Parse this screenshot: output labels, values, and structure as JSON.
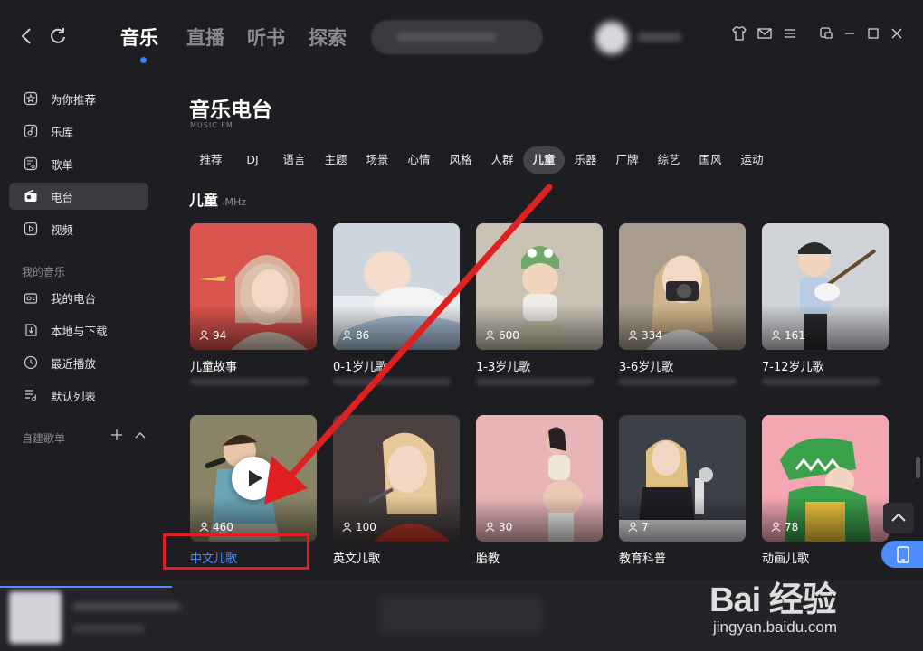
{
  "topbar": {
    "tabs": [
      "音乐",
      "直播",
      "听书",
      "探索"
    ],
    "active_tab": "音乐"
  },
  "sidebar": {
    "items": [
      {
        "label": "为你推荐",
        "icon": "star-icon"
      },
      {
        "label": "乐库",
        "icon": "music-library-icon"
      },
      {
        "label": "歌单",
        "icon": "playlist-icon"
      },
      {
        "label": "电台",
        "icon": "radio-icon",
        "active": true
      },
      {
        "label": "视频",
        "icon": "video-icon"
      }
    ],
    "my_music_title": "我的音乐",
    "my_items": [
      {
        "label": "我的电台",
        "icon": "my-radio-icon"
      },
      {
        "label": "本地与下载",
        "icon": "download-icon"
      },
      {
        "label": "最近播放",
        "icon": "clock-icon"
      },
      {
        "label": "默认列表",
        "icon": "list-icon"
      }
    ],
    "custom_title": "自建歌单"
  },
  "content": {
    "title": "音乐电台",
    "subtitle": "MUSIC FM",
    "categories": [
      "推荐",
      "DJ",
      "语言",
      "主题",
      "场景",
      "心情",
      "风格",
      "人群",
      "儿童",
      "乐器",
      "厂牌",
      "综艺",
      "国风",
      "运动"
    ],
    "active_category": "儿童",
    "section_title": "儿童",
    "section_unit": ".MHz",
    "cards": [
      {
        "name": "儿童故事",
        "count": "94",
        "color": "#d9534f"
      },
      {
        "name": "0-1岁儿歌",
        "count": "86",
        "color": "#cdd6de"
      },
      {
        "name": "1-3岁儿歌",
        "count": "600",
        "color": "#c9c2b4"
      },
      {
        "name": "3-6岁儿歌",
        "count": "334",
        "color": "#a89c8e"
      },
      {
        "name": "7-12岁儿歌",
        "count": "161",
        "color": "#cfd2d6"
      },
      {
        "name": "中文儿歌",
        "count": "460",
        "color": "#8a8466",
        "active": true
      },
      {
        "name": "英文儿歌",
        "count": "100",
        "color": "#4a4140"
      },
      {
        "name": "胎教",
        "count": "30",
        "color": "#e8b4b8"
      },
      {
        "name": "教育科普",
        "count": "7",
        "color": "#3c4048"
      },
      {
        "name": "动画儿歌",
        "count": "78",
        "color": "#f4a7b3"
      }
    ]
  },
  "watermark": {
    "logo": "Bai 经验",
    "url": "jingyan.baidu.com"
  },
  "colors": {
    "accent": "#4f8dff",
    "annotation_red": "#e02020"
  }
}
